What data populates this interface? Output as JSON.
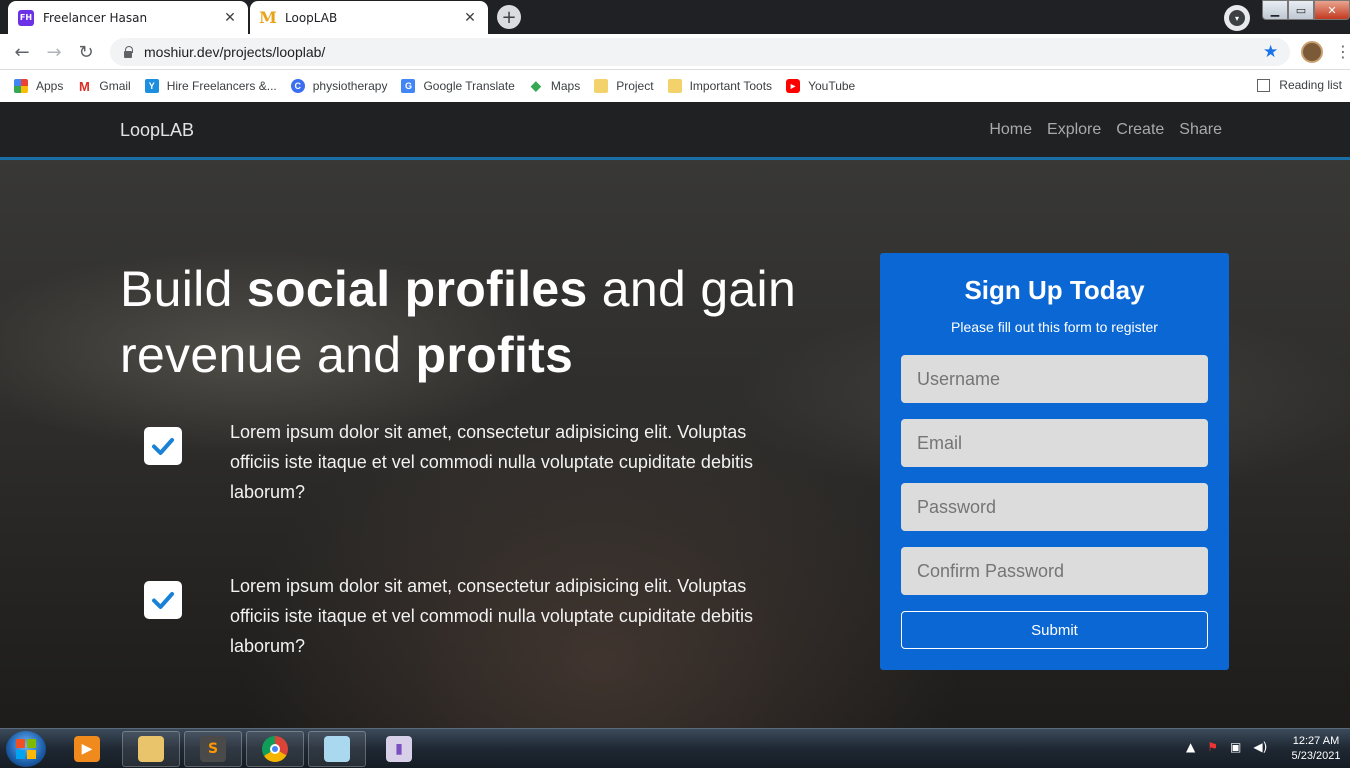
{
  "browser": {
    "tabs": [
      {
        "favicon": "FH",
        "title": "Freelancer Hasan",
        "close": "✕"
      },
      {
        "favicon": "M",
        "title": "LoopLAB",
        "close": "✕"
      }
    ],
    "new_tab": "+",
    "url": "moshiur.dev/projects/looplab/",
    "bookmarks": [
      {
        "label": "Apps",
        "icon": ""
      },
      {
        "label": "Gmail",
        "icon": "M"
      },
      {
        "label": "Hire Freelancers &...",
        "icon": "Y"
      },
      {
        "label": "physiotherapy",
        "icon": "C"
      },
      {
        "label": "Google Translate",
        "icon": "G"
      },
      {
        "label": "Maps",
        "icon": "◆"
      },
      {
        "label": "Project",
        "icon": ""
      },
      {
        "label": "Important Toots",
        "icon": ""
      },
      {
        "label": "YouTube",
        "icon": "▶"
      }
    ],
    "reading_list": "Reading list"
  },
  "site": {
    "brand": "LoopLAB",
    "nav": [
      "Home",
      "Explore",
      "Create",
      "Share"
    ],
    "hero": {
      "t1": "Build ",
      "t2": "social profiles",
      "t3": " and gain revenue and ",
      "t4": "profits"
    },
    "features": [
      "Lorem ipsum dolor sit amet, consectetur adipisicing elit. Voluptas officiis iste itaque et vel commodi nulla voluptate cupiditate debitis laborum?",
      "Lorem ipsum dolor sit amet, consectetur adipisicing elit. Voluptas officiis iste itaque et vel commodi nulla voluptate cupiditate debitis laborum?"
    ],
    "form": {
      "title": "Sign Up Today",
      "subtitle": "Please fill out this form to register",
      "username_placeholder": "Username",
      "email_placeholder": "Email",
      "password_placeholder": "Password",
      "confirm_placeholder": "Confirm Password",
      "submit": "Submit"
    }
  },
  "taskbar": {
    "time": "12:27 AM",
    "date": "5/23/2021"
  },
  "colors": {
    "accent": "#0a67d3",
    "nav_underline": "#1a6fa8"
  }
}
